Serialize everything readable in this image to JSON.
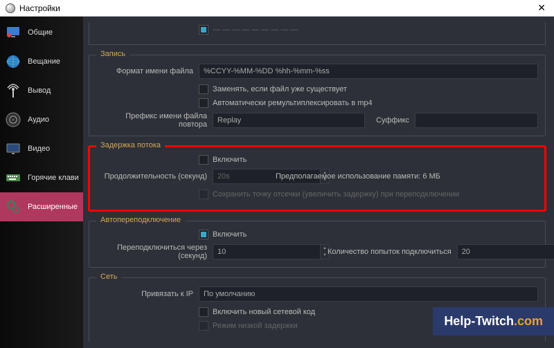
{
  "window": {
    "title": "Настройки"
  },
  "sidebar": {
    "items": [
      {
        "label": "Общие"
      },
      {
        "label": "Вещание"
      },
      {
        "label": "Вывод"
      },
      {
        "label": "Аудио"
      },
      {
        "label": "Видео"
      },
      {
        "label": "Горячие клави"
      },
      {
        "label": "Расширенные"
      }
    ]
  },
  "recording": {
    "title": "Запись",
    "filename_format_label": "Формат имени файла",
    "filename_format_value": "%CCYY-%MM-%DD %hh-%mm-%ss",
    "overwrite_label": "Заменять, если файл уже существует",
    "remux_label": "Автоматически ремультиплексировать в mp4",
    "replay_prefix_label": "Префикс имени файла повтора",
    "replay_prefix_value": "Replay",
    "suffix_label": "Суффикс",
    "suffix_value": ""
  },
  "delay": {
    "title": "Задержка потока",
    "enable_label": "Включить",
    "duration_label": "Продолжительность (секунд)",
    "duration_value": "20s",
    "memory_label": "Предполагаемое использование памяти: 6 МБ",
    "preserve_label": "Сохранить точку отсечки (увеличить задержку) при переподключении"
  },
  "reconnect": {
    "title": "Автопереподключение",
    "enable_label": "Включить",
    "retry_delay_label": "Переподключиться через (секунд)",
    "retry_delay_value": "10",
    "max_retries_label": "Количество попыток подключиться",
    "max_retries_value": "20"
  },
  "network": {
    "title": "Сеть",
    "bind_ip_label": "Привязать к IP",
    "bind_ip_value": "По умолчанию",
    "new_code_label": "Включить новый сетевой код",
    "low_latency_label": "Режим низкой задержки"
  },
  "watermark": {
    "text1": "Help-Twitch",
    "text2": ".com"
  }
}
